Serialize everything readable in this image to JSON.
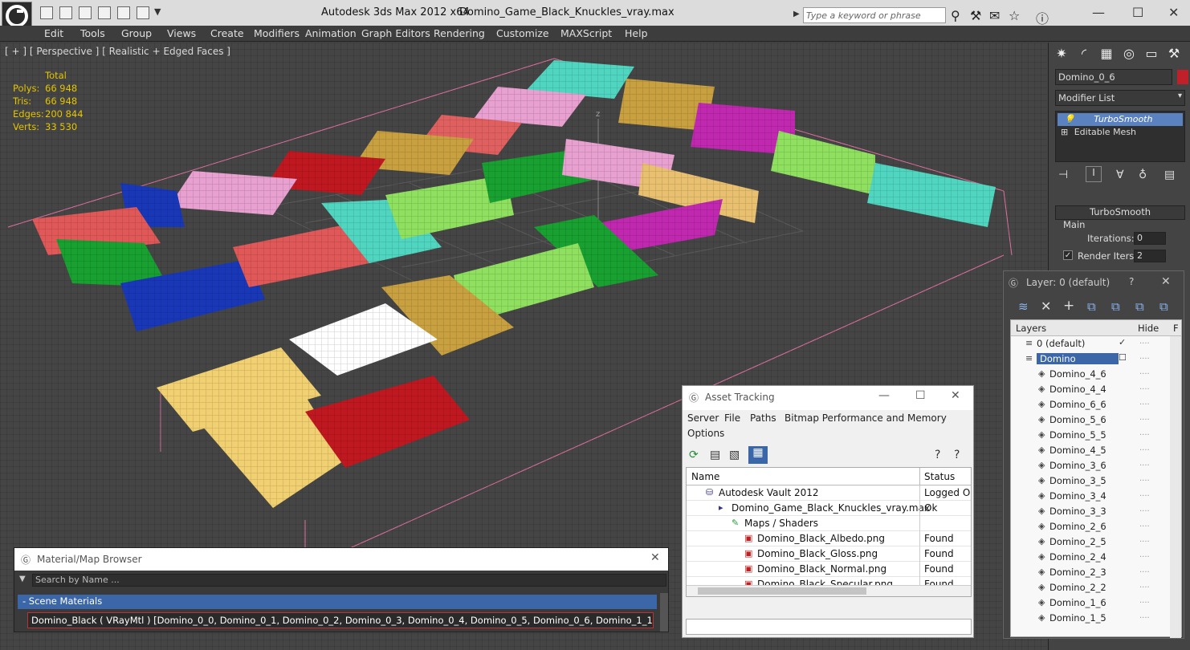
{
  "titlebar": {
    "app_title": "Autodesk 3ds Max  2012 x64",
    "file_name": "Domino_Game_Black_Knuckles_vray.max",
    "search_placeholder": "Type a keyword or phrase"
  },
  "menu": [
    "Edit",
    "Tools",
    "Group",
    "Views",
    "Create",
    "Modifiers",
    "Animation",
    "Graph Editors",
    "Rendering",
    "Customize",
    "MAXScript",
    "Help"
  ],
  "viewport": {
    "label": "[ + ] [ Perspective ] [ Realistic + Edged Faces ]",
    "stats_header": "Total",
    "stats": [
      {
        "label": "Polys:",
        "value": "66 948"
      },
      {
        "label": "Tris:",
        "value": "66 948"
      },
      {
        "label": "Edges:",
        "value": "200 844"
      },
      {
        "label": "Verts:",
        "value": "33 530"
      }
    ],
    "axis_label": "z"
  },
  "command_panel": {
    "object_name": "Domino_0_6",
    "object_color": "#c0202a",
    "modifier_list_label": "Modifier List",
    "stack": [
      "TurboSmooth",
      "Editable Mesh"
    ],
    "rollout_title": "TurboSmooth",
    "group_label": "Main",
    "iterations_label": "Iterations:",
    "iterations_value": "0",
    "render_iters_label": "Render Iters:",
    "render_iters_value": "2"
  },
  "layers": {
    "title": "Layer: 0 (default)",
    "help": "?",
    "col_layers": "Layers",
    "col_hide": "Hide",
    "col_f": "F",
    "rows": [
      {
        "name": "0 (default)",
        "level": 0,
        "selected": false
      },
      {
        "name": "Domino",
        "level": 0,
        "selected": true
      },
      {
        "name": "Domino_4_6",
        "level": 1
      },
      {
        "name": "Domino_4_4",
        "level": 1
      },
      {
        "name": "Domino_6_6",
        "level": 1
      },
      {
        "name": "Domino_5_6",
        "level": 1
      },
      {
        "name": "Domino_5_5",
        "level": 1
      },
      {
        "name": "Domino_4_5",
        "level": 1
      },
      {
        "name": "Domino_3_6",
        "level": 1
      },
      {
        "name": "Domino_3_5",
        "level": 1
      },
      {
        "name": "Domino_3_4",
        "level": 1
      },
      {
        "name": "Domino_3_3",
        "level": 1
      },
      {
        "name": "Domino_2_6",
        "level": 1
      },
      {
        "name": "Domino_2_5",
        "level": 1
      },
      {
        "name": "Domino_2_4",
        "level": 1
      },
      {
        "name": "Domino_2_3",
        "level": 1
      },
      {
        "name": "Domino_2_2",
        "level": 1
      },
      {
        "name": "Domino_1_6",
        "level": 1
      },
      {
        "name": "Domino_1_5",
        "level": 1
      }
    ]
  },
  "asset_tracking": {
    "title": "Asset Tracking",
    "menus": [
      "Server",
      "File",
      "Paths",
      "Bitmap Performance and Memory",
      "Options"
    ],
    "col_name": "Name",
    "col_status": "Status",
    "rows": [
      {
        "name": "Autodesk Vault 2012",
        "status": "Logged Out",
        "indent": 1
      },
      {
        "name": "Domino_Game_Black_Knuckles_vray.max",
        "status": "Ok",
        "indent": 2
      },
      {
        "name": "Maps / Shaders",
        "status": "",
        "indent": 3
      },
      {
        "name": "Domino_Black_Albedo.png",
        "status": "Found",
        "indent": 4
      },
      {
        "name": "Domino_Black_Gloss.png",
        "status": "Found",
        "indent": 4
      },
      {
        "name": "Domino_Black_Normal.png",
        "status": "Found",
        "indent": 4
      },
      {
        "name": "Domino_Black_Specular.png",
        "status": "Found",
        "indent": 4
      }
    ]
  },
  "material_browser": {
    "title": "Material/Map Browser",
    "search_placeholder": "Search by Name ...",
    "section": "- Scene Materials",
    "entry": "Domino_Black  ( VRayMtl ) [Domino_0_0, Domino_0_1, Domino_0_2, Domino_0_3, Domino_0_4, Domino_0_5, Domino_0_6, Domino_1_1, Domino_1_..."
  }
}
